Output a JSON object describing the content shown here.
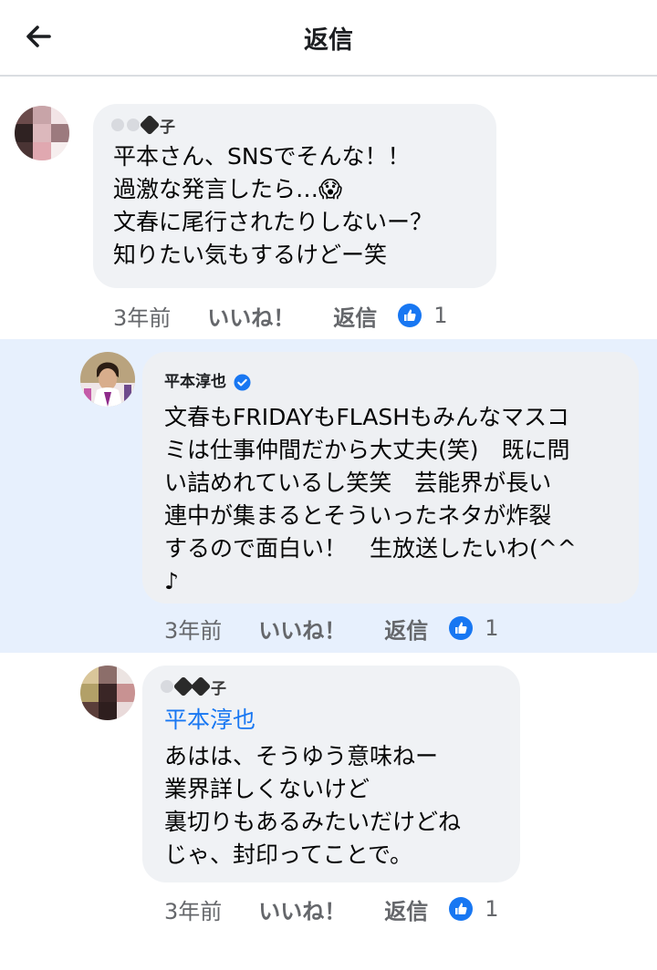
{
  "header": {
    "title": "返信"
  },
  "comments": [
    {
      "author_visible_char": "子",
      "body": "平本さん、SNSでそんな！！\n過激な発言したら…😱\n文春に尾行されたりしないー？\n知りたい気もするけどー笑",
      "time": "3年前",
      "like_label": "いいね！",
      "reply_label": "返信",
      "reaction_count": "1"
    },
    {
      "author": "平本淳也",
      "body": "文春もFRIDAYもFLASHもみんなマスコ\nミは仕事仲間だから大丈夫(笑)　既に問\nい詰めれているし笑笑　芸能界が長い\n連中が集まるとそういったネタが炸裂\nするので面白い！　生放送したいわ(^^\n♪",
      "time": "3年前",
      "like_label": "いいね！",
      "reply_label": "返信",
      "reaction_count": "1"
    },
    {
      "author_visible_char": "子",
      "mention": "平本淳也",
      "body": "あはは、そうゆう意味ねー\n業界詳しくないけど\n裏切りもあるみたいだけどね\nじゃ、封印ってことで。",
      "time": "3年前",
      "like_label": "いいね！",
      "reply_label": "返信",
      "reaction_count": "1"
    }
  ],
  "colors": {
    "link_blue": "#1877f2",
    "bubble_gray": "#f0f2f5",
    "highlight_blue": "#e7f0fd",
    "meta_gray": "#65676b"
  },
  "icons": {
    "back": "arrow-left-icon",
    "verified": "verified-badge-icon",
    "reaction": "thumbs-up-reaction-icon"
  }
}
